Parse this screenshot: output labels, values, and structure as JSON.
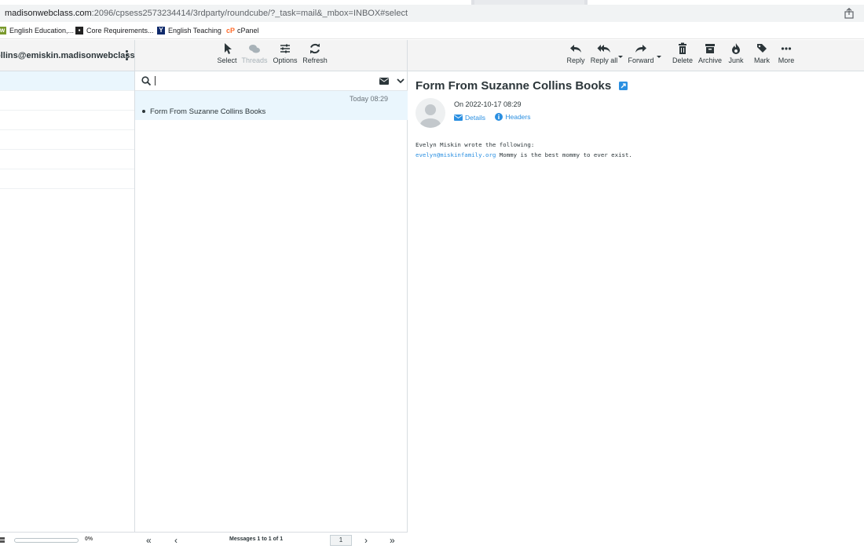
{
  "browser": {
    "url_host": "madisonwebclass.com",
    "url_path": ":2096/cpsess2573234414/3rdparty/roundcube/?_task=mail&_mbox=INBOX#select",
    "bookmarks": [
      {
        "label": "English Education,...",
        "icon": "bookmark-site-icon"
      },
      {
        "label": "Core Requirements...",
        "icon": "bookmark-site-icon"
      },
      {
        "label": "English Teaching",
        "icon": "bookmark-site-icon"
      },
      {
        "label": "cPanel",
        "icon": "cpanel-icon"
      }
    ]
  },
  "account": {
    "label": "ollins@emiskin.madisonwebclass...."
  },
  "quota": {
    "percent_label": "0%",
    "fill_fraction": 0.0
  },
  "list_toolbar": {
    "select": "Select",
    "threads": "Threads",
    "options": "Options",
    "refresh": "Refresh"
  },
  "message_toolbar": {
    "reply": "Reply",
    "reply_all": "Reply all",
    "forward": "Forward",
    "delete": "Delete",
    "archive": "Archive",
    "junk": "Junk",
    "mark": "Mark",
    "more": "More"
  },
  "search": {
    "value": ""
  },
  "messages": [
    {
      "subject": "Form From Suzanne Collins Books",
      "date": "Today 08:29"
    }
  ],
  "pager": {
    "count": "Messages 1 to 1 of 1",
    "page": "1"
  },
  "message": {
    "subject": "Form From Suzanne Collins Books",
    "date_line": "On 2022-10-17 08:29",
    "details": "Details",
    "headers": "Headers",
    "body_line1": "Evelyn Miskin wrote the following:",
    "body_email": "evelyn@miskinfamily.org",
    "body_text": "Mommy is the best mommy to ever exist."
  },
  "colors": {
    "accent": "#37beff",
    "link": "#2a8fe1",
    "selected_row": "#eaf6fd"
  }
}
